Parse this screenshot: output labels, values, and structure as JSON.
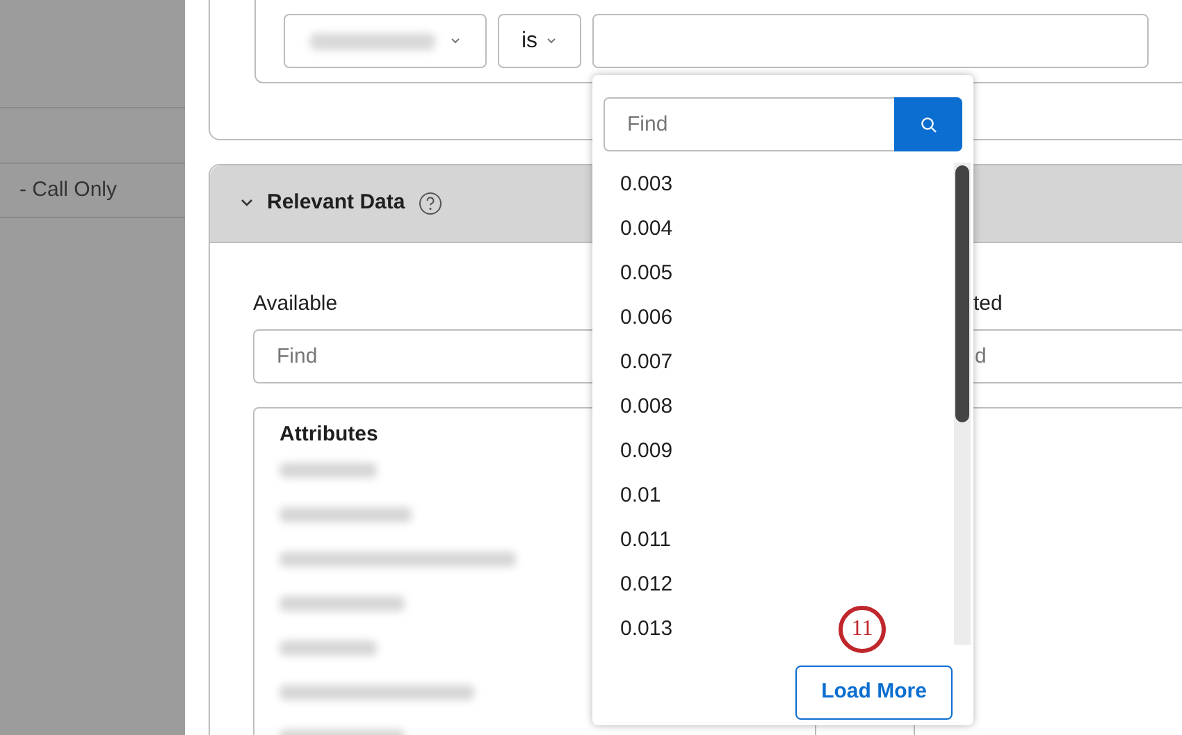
{
  "sidebar": {
    "items": [
      {
        "label": "- Call Only"
      }
    ]
  },
  "filter": {
    "operator": "is"
  },
  "relevant_data": {
    "title": "Relevant Data",
    "expanded": true,
    "available": {
      "label": "Available",
      "search_placeholder": "Find",
      "group": "Attributes"
    },
    "selected": {
      "label": "ted",
      "search_placeholder": "d"
    }
  },
  "dropdown_popup": {
    "search_placeholder": "Find",
    "options": [
      "0.003",
      "0.004",
      "0.005",
      "0.006",
      "0.007",
      "0.008",
      "0.009",
      "0.01",
      "0.011",
      "0.012",
      "0.013"
    ],
    "load_more": "Load More"
  },
  "annotation": {
    "label": "11"
  }
}
